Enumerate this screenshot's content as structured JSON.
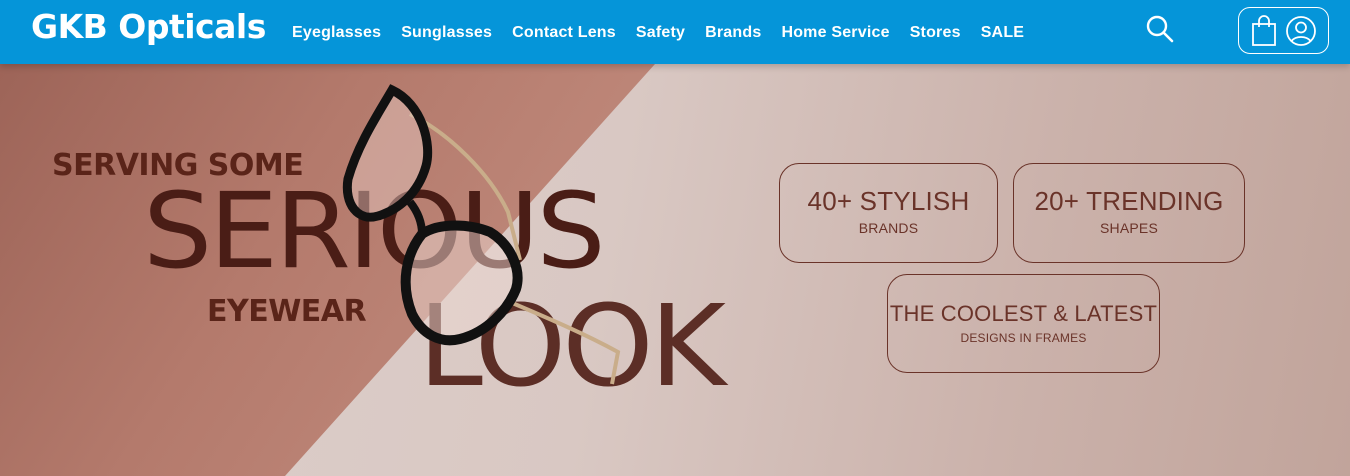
{
  "header": {
    "logo": "GKB Opticals",
    "nav": [
      "Eyeglasses",
      "Sunglasses",
      "Contact Lens",
      "Safety",
      "Brands",
      "Home Service",
      "Stores",
      "SALE"
    ],
    "icons": [
      "search-icon",
      "shopping-bag-icon",
      "user-icon"
    ],
    "brand_color": "#0595d9"
  },
  "banner": {
    "line1": "SERVING SOME",
    "line2": "SERIOUS",
    "line3": "EYEWEAR",
    "line4": "LOOK",
    "features": [
      {
        "big": "40+ STYLISH",
        "small": "BRANDS"
      },
      {
        "big": "20+ TRENDING",
        "small": "SHAPES"
      },
      {
        "big": "THE COOLEST & LATEST",
        "small": "DESIGNS IN FRAMES"
      }
    ],
    "text_color": "#5a2419"
  }
}
